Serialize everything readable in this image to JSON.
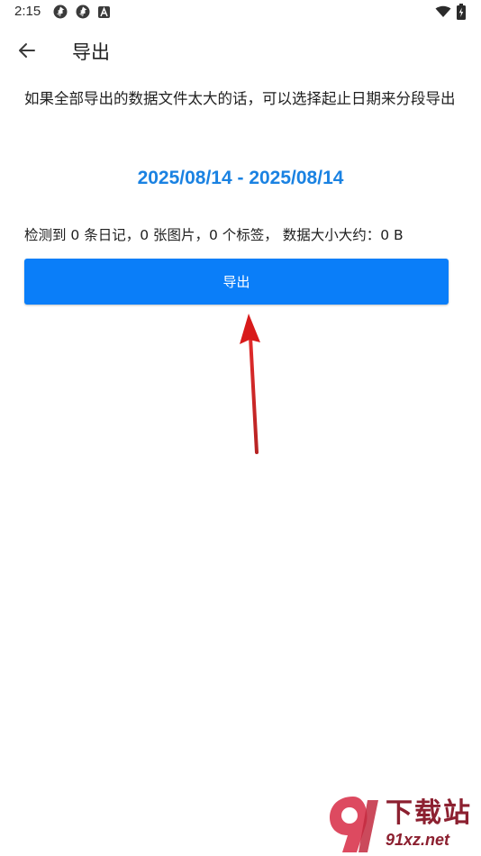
{
  "status_bar": {
    "time": "2:15",
    "icons": [
      "sync-icon",
      "sync-icon",
      "font-a-icon",
      "wifi-icon",
      "battery-charging-icon"
    ]
  },
  "app_bar": {
    "back_icon": "arrow-left-icon",
    "title": "导出"
  },
  "description": "如果全部导出的数据文件太大的话，可以选择起止日期来分段导出",
  "date_range": "2025/08/14 - 2025/08/14",
  "summary": "检测到 0 条日记，0 张图片，0 个标签， 数据大小大约：0 B",
  "export_button": {
    "label": "导出"
  },
  "annotation": {
    "icon": "red-arrow-up-icon"
  },
  "watermark": {
    "title": "下载站",
    "url": "91xz.net"
  },
  "colors": {
    "accent": "#1a82e2",
    "button": "#0a7ef9",
    "annotation": "#d81a1a",
    "watermark": "#8c2030"
  }
}
